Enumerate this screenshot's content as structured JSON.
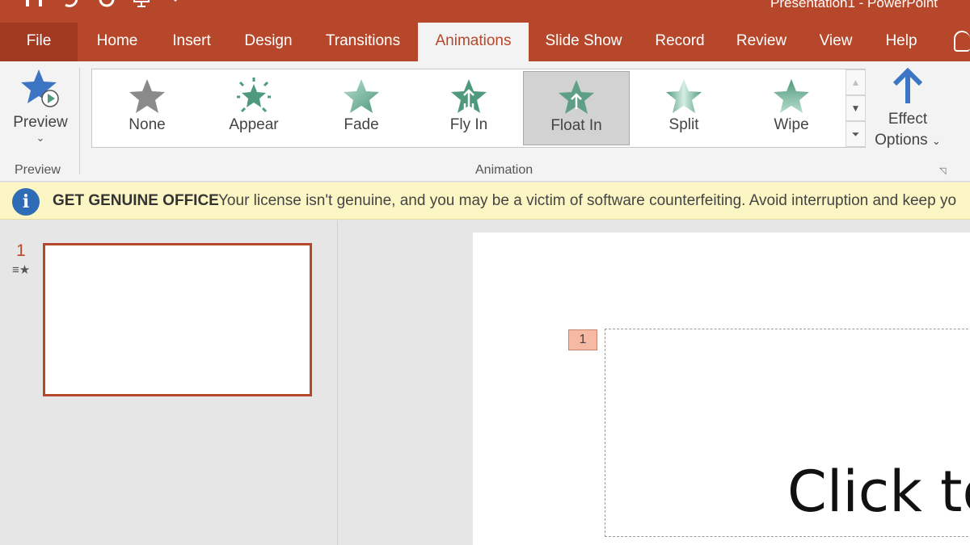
{
  "window": {
    "title": "Presentation1 - PowerPoint",
    "quick_access": [
      "save-icon",
      "undo-icon",
      "redo-icon",
      "present-from-start-icon",
      "customize-qat-icon"
    ]
  },
  "tabs": [
    "File",
    "Home",
    "Insert",
    "Design",
    "Transitions",
    "Animations",
    "Slide Show",
    "Record",
    "Review",
    "View",
    "Help"
  ],
  "active_tab": "Animations",
  "ribbon": {
    "preview_group": {
      "button_label": "Preview",
      "group_label": "Preview"
    },
    "animation_group": {
      "gallery": [
        "None",
        "Appear",
        "Fade",
        "Fly In",
        "Float In",
        "Split",
        "Wipe"
      ],
      "selected": "Float In",
      "group_label": "Animation",
      "effect_options_line1": "Effect",
      "effect_options_line2": "Options"
    }
  },
  "notification": {
    "title": "GET GENUINE OFFICE",
    "message": "Your license isn't genuine, and you may be a victim of software counterfeiting. Avoid interruption and keep yo"
  },
  "thumbnails": [
    {
      "number": "1",
      "has_animation": true
    }
  ],
  "slide": {
    "animation_tag": "1",
    "placeholder_text": "Click to"
  },
  "colors": {
    "accent": "#b7472a",
    "info_blue": "#2e6db5",
    "star_green": "#4f9a7c",
    "notify_bg": "#fcf6c4"
  }
}
